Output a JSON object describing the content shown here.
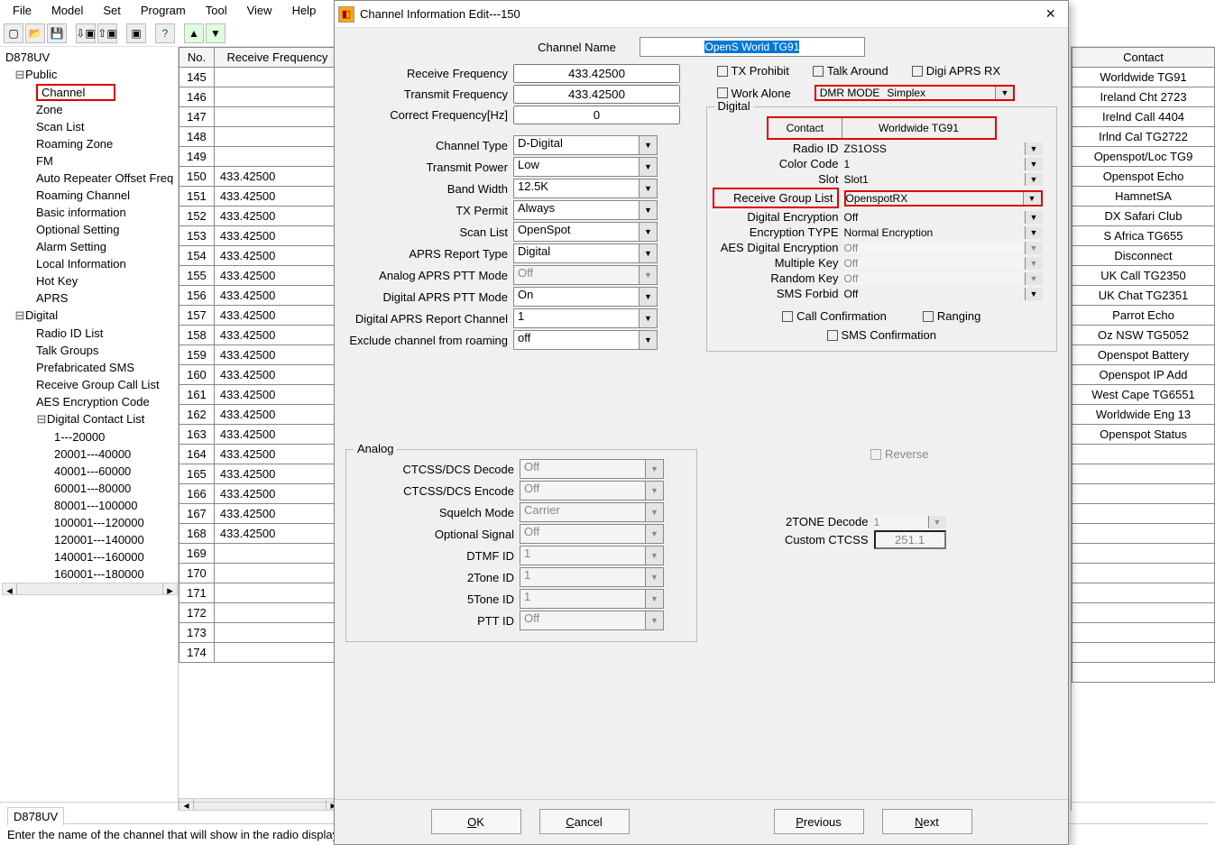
{
  "menu": [
    "File",
    "Model",
    "Set",
    "Program",
    "Tool",
    "View",
    "Help"
  ],
  "toolbar_icons": [
    "new",
    "open",
    "save",
    "sep",
    "link1",
    "link2",
    "sep",
    "radio",
    "sep",
    "help",
    "sep",
    "up",
    "down"
  ],
  "tree": {
    "root": "D878UV",
    "public": "Public",
    "public_items": [
      "Channel",
      "Zone",
      "Scan List",
      "Roaming Zone",
      "FM",
      "Auto Repeater Offset Freq",
      "Roaming Channel",
      "Basic information",
      "Optional Setting",
      "Alarm Setting",
      "Local Information",
      "Hot Key",
      "APRS"
    ],
    "digital": "Digital",
    "digital_items": [
      "Radio ID List",
      "Talk Groups",
      "Prefabricated SMS",
      "Receive Group Call List",
      "AES Encryption Code"
    ],
    "dcl": "Digital Contact List",
    "dcl_items": [
      "1---20000",
      "20001---40000",
      "40001---60000",
      "60001---80000",
      "80001---100000",
      "100001---120000",
      "120001---140000",
      "140001---160000",
      "160001---180000"
    ]
  },
  "grid": {
    "headers": [
      "No.",
      "Receive Frequency"
    ],
    "rows": [
      {
        "no": "145",
        "rx": ""
      },
      {
        "no": "146",
        "rx": ""
      },
      {
        "no": "147",
        "rx": ""
      },
      {
        "no": "148",
        "rx": ""
      },
      {
        "no": "149",
        "rx": ""
      },
      {
        "no": "150",
        "rx": "433.42500"
      },
      {
        "no": "151",
        "rx": "433.42500"
      },
      {
        "no": "152",
        "rx": "433.42500"
      },
      {
        "no": "153",
        "rx": "433.42500"
      },
      {
        "no": "154",
        "rx": "433.42500"
      },
      {
        "no": "155",
        "rx": "433.42500"
      },
      {
        "no": "156",
        "rx": "433.42500"
      },
      {
        "no": "157",
        "rx": "433.42500"
      },
      {
        "no": "158",
        "rx": "433.42500"
      },
      {
        "no": "159",
        "rx": "433.42500"
      },
      {
        "no": "160",
        "rx": "433.42500"
      },
      {
        "no": "161",
        "rx": "433.42500"
      },
      {
        "no": "162",
        "rx": "433.42500"
      },
      {
        "no": "163",
        "rx": "433.42500"
      },
      {
        "no": "164",
        "rx": "433.42500"
      },
      {
        "no": "165",
        "rx": "433.42500"
      },
      {
        "no": "166",
        "rx": "433.42500"
      },
      {
        "no": "167",
        "rx": "433.42500"
      },
      {
        "no": "168",
        "rx": "433.42500"
      },
      {
        "no": "169",
        "rx": ""
      },
      {
        "no": "170",
        "rx": ""
      },
      {
        "no": "171",
        "rx": ""
      },
      {
        "no": "172",
        "rx": ""
      },
      {
        "no": "173",
        "rx": ""
      },
      {
        "no": "174",
        "rx": ""
      }
    ]
  },
  "contacts": {
    "header": "Contact",
    "items": [
      "Worldwide TG91",
      "Ireland Cht 2723",
      "Irelnd Call 4404",
      "Irlnd Cal TG2722",
      "Openspot/Loc TG9",
      "Openspot Echo",
      "HamnetSA",
      "DX Safari Club",
      "S Africa TG655",
      "Disconnect",
      "UK Call TG2350",
      "UK Chat TG2351",
      "Parrot Echo",
      "Oz NSW TG5052",
      "Openspot Battery",
      "Openspot IP Add",
      "West Cape TG6551",
      "Worldwide Eng 13",
      "Openspot Status"
    ]
  },
  "dlg": {
    "title": "Channel Information Edit---150",
    "channel_name_label": "Channel Name",
    "channel_name": "OpenS World TG91",
    "left": {
      "rx_label": "Receive Frequency",
      "rx": "433.42500",
      "tx_label": "Transmit Frequency",
      "tx": "433.42500",
      "cf_label": "Correct Frequency[Hz]",
      "cf": "0",
      "ct_label": "Channel Type",
      "ct": "D-Digital",
      "tp_label": "Transmit Power",
      "tp": "Low",
      "bw_label": "Band Width",
      "bw": "12.5K",
      "txp_label": "TX Permit",
      "txp": "Always",
      "sl_label": "Scan List",
      "sl": "OpenSpot",
      "art_label": "APRS Report Type",
      "art": "Digital",
      "apm_label": "Analog APRS PTT Mode",
      "apm": "Off",
      "dpm_label": "Digital APRS PTT Mode",
      "dpm": "On",
      "darc_label": "Digital APRS Report Channel",
      "darc": "1",
      "ecr_label": "Exclude channel from roaming",
      "ecr": "off"
    },
    "right_checks": {
      "tx_prohibit": "TX Prohibit",
      "talk_around": "Talk Around",
      "digi_aprs_rx": "Digi APRS RX",
      "work_alone": "Work Alone"
    },
    "dmr_label": "DMR MODE",
    "dmr": "Simplex",
    "digital_legend": "Digital",
    "digital": {
      "contact_label": "Contact",
      "contact": "Worldwide TG91",
      "rid_label": "Radio ID",
      "rid": "ZS1OSS",
      "cc_label": "Color Code",
      "cc": "1",
      "slot_label": "Slot",
      "slot": "Slot1",
      "rgl_label": "Receive Group List",
      "rgl": "OpenspotRX",
      "de_label": "Digital Encryption",
      "de": "Off",
      "et_label": "Encryption TYPE",
      "et": "Normal Encryption",
      "aes_label": "AES Digital Encryption",
      "aes": "Off",
      "mk_label": "Multiple Key",
      "mk": "Off",
      "rk_label": "Random Key",
      "rk": "Off",
      "sms_label": "SMS Forbid",
      "sms": "Off",
      "call_conf": "Call Confirmation",
      "ranging": "Ranging",
      "sms_conf": "SMS Confirmation"
    },
    "analog_legend": "Analog",
    "analog": {
      "dec_label": "CTCSS/DCS Decode",
      "dec": "Off",
      "enc_label": "CTCSS/DCS Encode",
      "enc": "Off",
      "sq_label": "Squelch Mode",
      "sq": "Carrier",
      "os_label": "Optional Signal",
      "os": "Off",
      "dtmf_label": "DTMF ID",
      "dtmf": "1",
      "t2_label": "2Tone ID",
      "t2": "1",
      "t5_label": "5Tone ID",
      "t5": "1",
      "ptt_label": "PTT ID",
      "ptt": "Off",
      "reverse": "Reverse",
      "t2d_label": "2TONE Decode",
      "t2d": "1",
      "cc_label": "Custom CTCSS",
      "cc": "251.1"
    },
    "buttons": {
      "ok": "OK",
      "cancel": "Cancel",
      "prev": "Previous",
      "next": "Next"
    }
  },
  "status": {
    "title": "D878UV",
    "text": "Enter the name of the channel that will show in the radio display"
  }
}
